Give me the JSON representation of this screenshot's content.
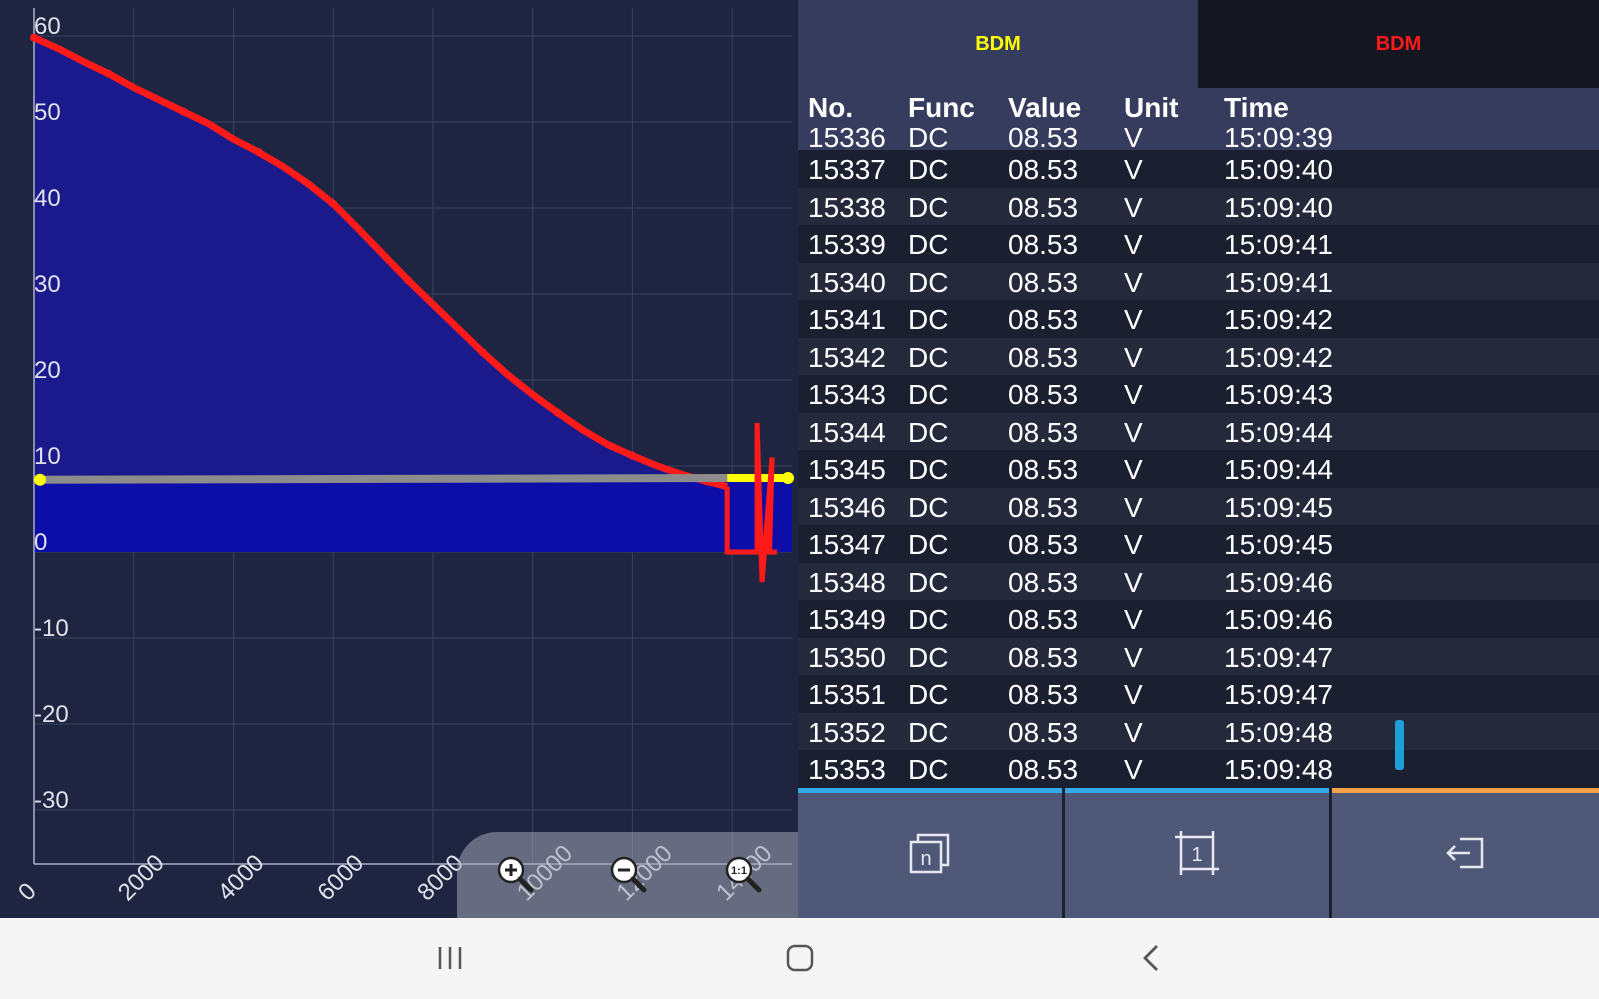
{
  "chart_data": {
    "type": "area",
    "xlim": [
      0,
      15200
    ],
    "ylim": [
      -37,
      62
    ],
    "x_ticks": [
      0,
      2000,
      4000,
      6000,
      8000,
      10000,
      12000,
      14000
    ],
    "y_ticks": [
      60,
      50,
      40,
      30,
      20,
      10,
      0,
      -10,
      -20,
      -30
    ],
    "grid": true,
    "series": [
      {
        "color": "#ff1a1a",
        "x": [
          0,
          500,
          1000,
          1500,
          2000,
          2500,
          3000,
          3500,
          4000,
          4500,
          5000,
          5500,
          6000,
          6500,
          7000,
          7500,
          8000,
          8500,
          9000,
          9500,
          10000,
          10500,
          11000,
          11500,
          12000,
          12500,
          13000,
          13500,
          13900
        ],
        "y": [
          59.8,
          58.5,
          57.0,
          55.6,
          54.0,
          52.6,
          51.2,
          49.8,
          48.0,
          46.5,
          44.8,
          42.8,
          40.5,
          37.6,
          34.6,
          31.6,
          28.8,
          26.0,
          23.2,
          20.6,
          18.3,
          16.2,
          14.2,
          12.5,
          11.2,
          10.0,
          9.0,
          8.2,
          7.6
        ]
      },
      {
        "color": "#8c8c8c",
        "x": [
          0,
          13900
        ],
        "y": [
          8.4,
          8.6
        ]
      },
      {
        "color": "#ffff00",
        "x": [
          13900,
          15200
        ],
        "y": [
          8.6,
          8.6
        ]
      }
    ],
    "area_fill": "#1a1a8c",
    "area_fill_lower": "#0d0da8"
  },
  "zoom": {
    "zoom_in": "zoom-in-icon",
    "zoom_out": "zoom-out-icon",
    "zoom_reset": "zoom-reset-icon",
    "reset_label": "1:1"
  },
  "tabs": [
    {
      "label": "BDM",
      "color": "#ffff00"
    },
    {
      "label": "BDM",
      "color": "#ff1a1a"
    }
  ],
  "table": {
    "headers": [
      "No.",
      "Func",
      "Value",
      "Unit",
      "Time"
    ],
    "partial_row": [
      "15336",
      "DC",
      "08.53",
      "V",
      "15:09:39"
    ],
    "rows": [
      [
        "15337",
        "DC",
        "08.53",
        "V",
        "15:09:40"
      ],
      [
        "15338",
        "DC",
        "08.53",
        "V",
        "15:09:40"
      ],
      [
        "15339",
        "DC",
        "08.53",
        "V",
        "15:09:41"
      ],
      [
        "15340",
        "DC",
        "08.53",
        "V",
        "15:09:41"
      ],
      [
        "15341",
        "DC",
        "08.53",
        "V",
        "15:09:42"
      ],
      [
        "15342",
        "DC",
        "08.53",
        "V",
        "15:09:42"
      ],
      [
        "15343",
        "DC",
        "08.53",
        "V",
        "15:09:43"
      ],
      [
        "15344",
        "DC",
        "08.53",
        "V",
        "15:09:44"
      ],
      [
        "15345",
        "DC",
        "08.53",
        "V",
        "15:09:44"
      ],
      [
        "15346",
        "DC",
        "08.53",
        "V",
        "15:09:45"
      ],
      [
        "15347",
        "DC",
        "08.53",
        "V",
        "15:09:45"
      ],
      [
        "15348",
        "DC",
        "08.53",
        "V",
        "15:09:46"
      ],
      [
        "15349",
        "DC",
        "08.53",
        "V",
        "15:09:46"
      ],
      [
        "15350",
        "DC",
        "08.53",
        "V",
        "15:09:47"
      ],
      [
        "15351",
        "DC",
        "08.53",
        "V",
        "15:09:47"
      ],
      [
        "15352",
        "DC",
        "08.53",
        "V",
        "15:09:48"
      ],
      [
        "15353",
        "DC",
        "08.53",
        "V",
        "15:09:48"
      ]
    ]
  },
  "bottom_buttons": [
    {
      "icon": "n-pages-icon",
      "label": "n",
      "indicator": "#35a9e6"
    },
    {
      "icon": "single-page-crop-icon",
      "label": "1",
      "indicator": "#35a9e6"
    },
    {
      "icon": "exit-icon",
      "indicator": "#f5a24a"
    }
  ],
  "navbar": {
    "recents": "recents-icon",
    "home": "home-icon",
    "back": "back-icon"
  }
}
